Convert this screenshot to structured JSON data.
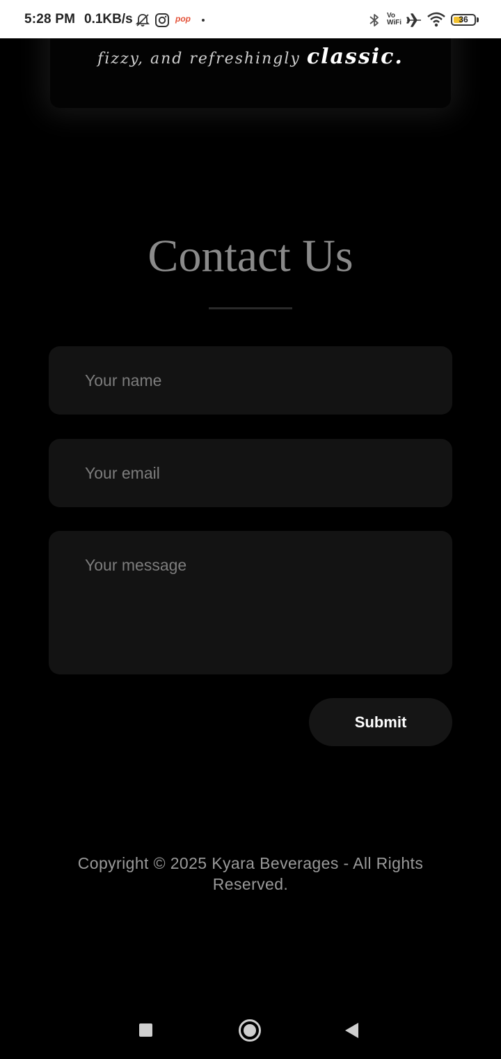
{
  "status_bar": {
    "time": "5:28 PM",
    "speed": "0.1KB/s",
    "pop_label": "pop",
    "vowifi_top": "Vo",
    "vowifi_bottom": "WiFi",
    "battery_level": "36",
    "icons": [
      "mute-icon",
      "instagram-icon",
      "pop-icon",
      "bluetooth-icon",
      "vowifi-icon",
      "airplane-icon",
      "wifi-icon",
      "battery-icon"
    ]
  },
  "hero": {
    "tagline": "fizzy, and refreshingly",
    "emphasis": "classic."
  },
  "contact": {
    "title": "Contact Us",
    "name_placeholder": "Your name",
    "email_placeholder": "Your email",
    "message_placeholder": "Your message",
    "submit_label": "Submit"
  },
  "footer": {
    "copyright": "Copyright © 2025 Kyara Beverages - All Rights Reserved."
  },
  "nav": {
    "icons": [
      "recent-apps-icon",
      "home-icon",
      "back-icon"
    ]
  },
  "colors": {
    "background": "#000000",
    "field_bg": "#131313",
    "title": "#8a8a8a",
    "placeholder": "#7d7d7d"
  }
}
